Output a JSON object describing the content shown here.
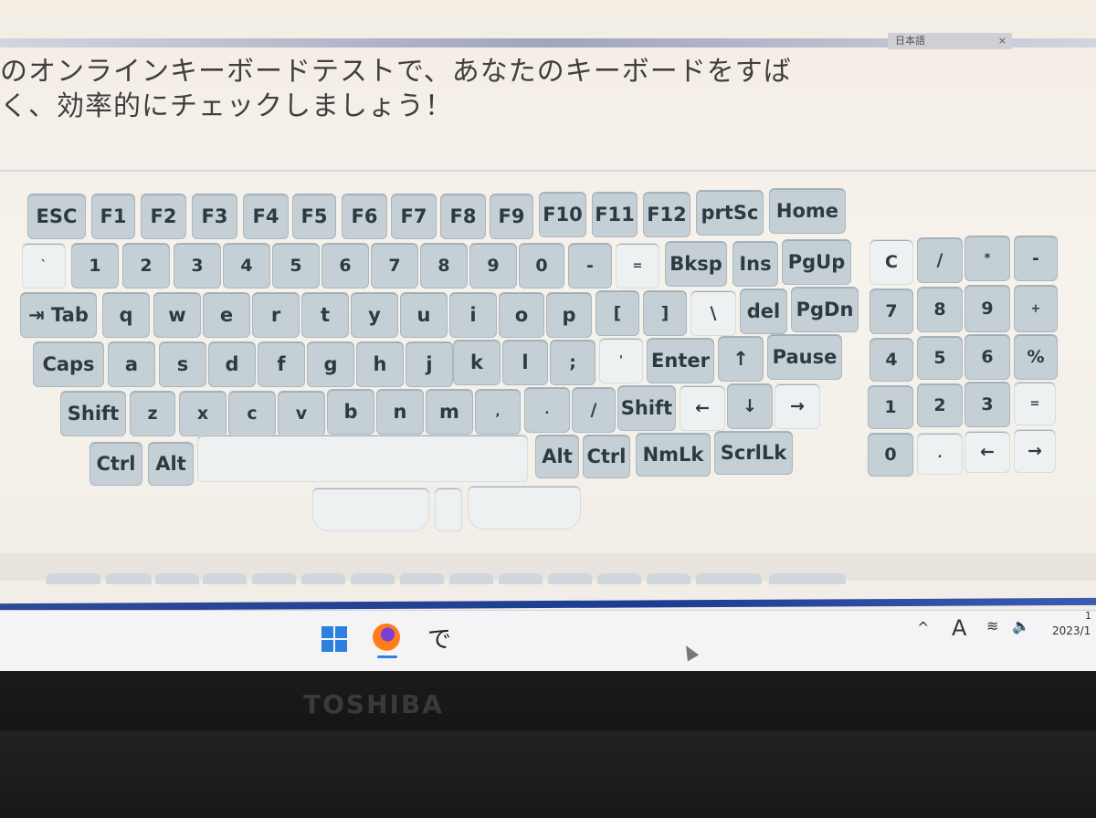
{
  "header": {
    "lang_badge": "日本語",
    "close": "×",
    "line1": "のオンラインキーボードテストで、あなたのキーボードをすば",
    "line2": "く、効率的にチェックしましょう！"
  },
  "keyboard": {
    "row_function": [
      "ESC",
      "F1",
      "F2",
      "F3",
      "F4",
      "F5",
      "F6",
      "F7",
      "F8",
      "F9",
      "F10",
      "F11",
      "F12",
      "prtSc",
      "Home"
    ],
    "row_number": [
      "`",
      "1",
      "2",
      "3",
      "4",
      "5",
      "6",
      "7",
      "8",
      "9",
      "0",
      "-",
      "=",
      "Bksp",
      "Ins",
      "PgUp"
    ],
    "row_tab": [
      "⇥ Tab",
      "q",
      "w",
      "e",
      "r",
      "t",
      "y",
      "u",
      "i",
      "o",
      "p",
      "[",
      "]",
      "\\",
      "del",
      "PgDn"
    ],
    "row_caps": [
      "Caps",
      "a",
      "s",
      "d",
      "f",
      "g",
      "h",
      "j",
      "k",
      "l",
      ";",
      "'",
      "Enter",
      "↑",
      "Pause"
    ],
    "row_shift": [
      "Shift",
      "z",
      "x",
      "c",
      "v",
      "b",
      "n",
      "m",
      ",",
      ".",
      "/",
      "Shift",
      "←",
      "↓",
      "→"
    ],
    "row_ctrl": [
      "Ctrl",
      "Alt",
      "",
      "Alt",
      "Ctrl",
      "NmLk",
      "ScrlLk"
    ],
    "numpad": {
      "row1": [
        "C",
        "/",
        "*",
        "-"
      ],
      "row2": [
        "7",
        "8",
        "9",
        "+"
      ],
      "row3": [
        "4",
        "5",
        "6",
        "%"
      ],
      "row4": [
        "1",
        "2",
        "3",
        "="
      ],
      "row5": [
        "0",
        ".",
        "←",
        "→"
      ]
    }
  },
  "taskbar": {
    "app_label": "で",
    "tray_chevron": "^",
    "ime": "A",
    "wifi": "≋",
    "volume": "🔈",
    "date": "2023/1",
    "time": "1"
  },
  "bezel": {
    "brand": "TOSHIBA"
  },
  "colors": {
    "key": "#c5cfd6",
    "key_light": "#eef1f1",
    "taskbar": "#f4f4f6",
    "accent": "#2f7fe0"
  }
}
